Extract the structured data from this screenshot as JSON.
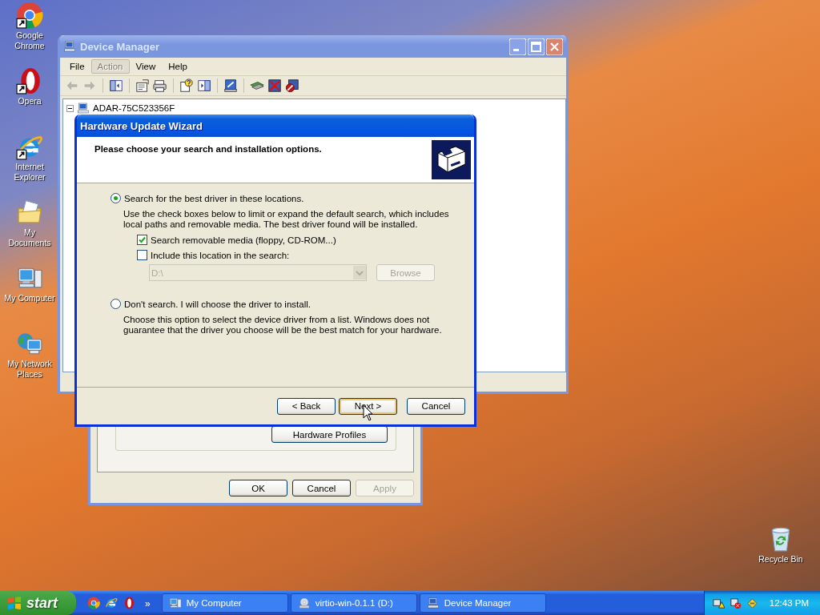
{
  "desktop_icons": [
    {
      "label": "Google Chrome",
      "kind": "chrome",
      "shortcut": true
    },
    {
      "label": "Opera",
      "kind": "opera",
      "shortcut": true
    },
    {
      "label": "Internet Explorer",
      "kind": "ie",
      "shortcut": true
    },
    {
      "label": "My Documents",
      "kind": "documents",
      "shortcut": false
    },
    {
      "label": "My Computer",
      "kind": "computer",
      "shortcut": false
    },
    {
      "label": "My Network Places",
      "kind": "network",
      "shortcut": false
    }
  ],
  "recycle_bin": {
    "label": "Recycle Bin"
  },
  "device_manager": {
    "title": "Device Manager",
    "menu": [
      {
        "label": "File",
        "disabled": false,
        "highlighted": false
      },
      {
        "label": "Action",
        "disabled": true,
        "highlighted": true
      },
      {
        "label": "View",
        "disabled": false,
        "highlighted": false
      },
      {
        "label": "Help",
        "disabled": false,
        "highlighted": false
      }
    ],
    "tree": [
      {
        "label": "ADAR-75C523356F",
        "expanded": true
      }
    ]
  },
  "properties_dialog": {
    "group_button": "Hardware Profiles",
    "buttons": [
      {
        "label": "OK",
        "disabled": false
      },
      {
        "label": "Cancel",
        "disabled": false
      },
      {
        "label": "Apply",
        "disabled": true
      }
    ]
  },
  "wizard": {
    "title": "Hardware Update Wizard",
    "heading": "Please choose your search and installation options.",
    "options": [
      {
        "label": "Search for the best driver in these locations.",
        "selected": true,
        "description": "Use the check boxes below to limit or expand the default search, which includes local paths and removable media. The best driver found will be installed.",
        "checkboxes": [
          {
            "label": "Search removable media (floppy, CD-ROM...)",
            "checked": true
          },
          {
            "label": "Include this location in the search:",
            "checked": false
          }
        ],
        "location": {
          "value": "D:\\",
          "disabled": true
        },
        "browse": {
          "label": "Browse",
          "disabled": true
        }
      },
      {
        "label": "Don't search. I will choose the driver to install.",
        "selected": false,
        "description": "Choose this option to select the device driver from a list.  Windows does not guarantee that the driver you choose will be the best match for your hardware."
      }
    ],
    "buttons": [
      {
        "label": "< Back",
        "default": false
      },
      {
        "label": "Next >",
        "default": true
      },
      {
        "label": "Cancel",
        "default": false
      }
    ]
  },
  "taskbar": {
    "start": "start",
    "quick_launch": [
      {
        "kind": "chrome"
      },
      {
        "kind": "ie"
      },
      {
        "kind": "opera"
      }
    ],
    "overflow": "»",
    "tasks": [
      {
        "label": "My Computer",
        "kind": "computer"
      },
      {
        "label": "virtio-win-0.1.1 (D:)",
        "kind": "cd"
      },
      {
        "label": "Device Manager",
        "kind": "devmgr"
      }
    ],
    "clock": "12:43 PM"
  }
}
